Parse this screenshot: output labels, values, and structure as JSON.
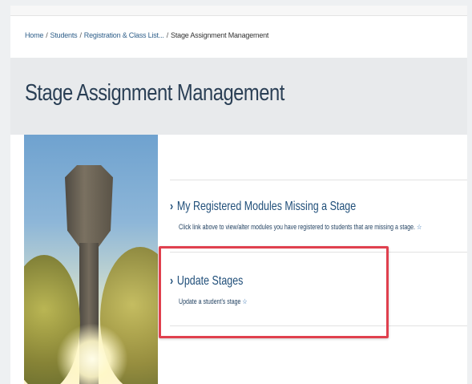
{
  "breadcrumb": {
    "items": [
      "Home",
      "Students",
      "Registration & Class List...",
      "Stage Assignment Management"
    ],
    "separator": "/"
  },
  "page": {
    "title": "Stage Assignment Management"
  },
  "links": [
    {
      "label": "My Registered Modules Missing a Stage",
      "description": "Click link above to view/alter modules you have registered to students that are missing a stage."
    },
    {
      "label": "Update Stages",
      "description": "Update a student's stage"
    }
  ],
  "icons": {
    "chevron": "›",
    "favorite_star": "☆"
  },
  "colors": {
    "link": "#1f4e79",
    "highlight": "#e0404e"
  }
}
